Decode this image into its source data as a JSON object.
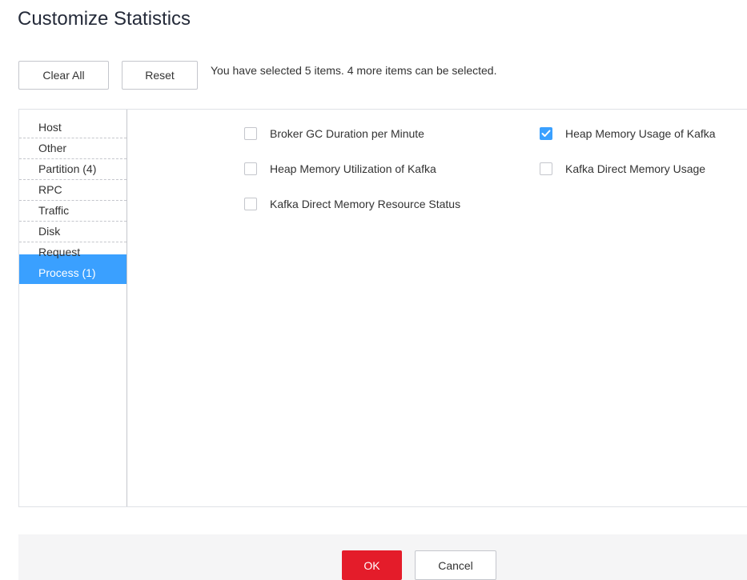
{
  "dialog": {
    "title": "Customize Statistics"
  },
  "toolbar": {
    "clear_all_label": "Clear All",
    "reset_label": "Reset",
    "selection_hint": "You have selected 5 items. 4 more items can be selected."
  },
  "categories": {
    "items": [
      {
        "label": "Host",
        "active": false
      },
      {
        "label": "Other",
        "active": false
      },
      {
        "label": "Partition (4)",
        "active": false
      },
      {
        "label": "RPC",
        "active": false
      },
      {
        "label": "Traffic",
        "active": false
      },
      {
        "label": "Disk",
        "active": false
      },
      {
        "label": "Request",
        "active": false
      },
      {
        "label": "Process (1)",
        "active": true
      }
    ]
  },
  "options": {
    "items": [
      {
        "label": "Broker GC Duration per Minute",
        "checked": false
      },
      {
        "label": "Heap Memory Usage of Kafka",
        "checked": true
      },
      {
        "label": "Heap Memory Utilization of Kafka",
        "checked": false
      },
      {
        "label": "Kafka Direct Memory Usage",
        "checked": false
      },
      {
        "label": "Kafka Direct Memory Resource Status",
        "checked": false
      }
    ]
  },
  "footer": {
    "ok_label": "OK",
    "cancel_label": "Cancel"
  },
  "colors": {
    "accent": "#3aa0ff",
    "primary_button": "#e41c2a",
    "footer_background": "#f5f5f6"
  },
  "icons": {
    "checkbox_checked": "checkmark-icon"
  }
}
